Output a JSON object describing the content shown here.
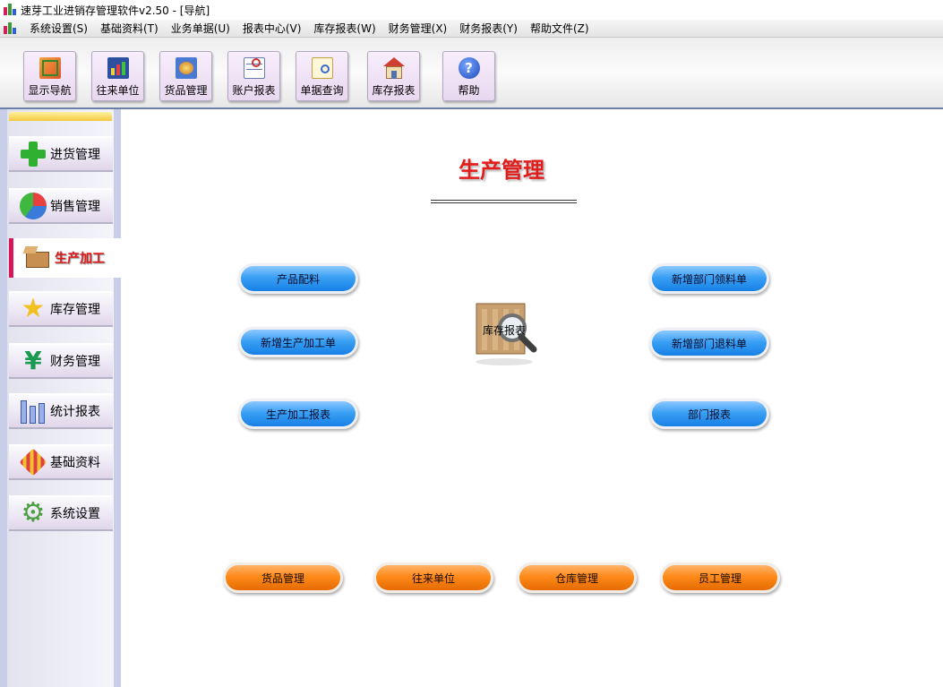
{
  "window": {
    "title": "速芽工业进销存管理软件v2.50 - [导航]"
  },
  "menu": [
    "系统设置(S)",
    "基础资料(T)",
    "业务单据(U)",
    "报表中心(V)",
    "库存报表(W)",
    "财务管理(X)",
    "财务报表(Y)",
    "帮助文件(Z)"
  ],
  "toolbar": [
    {
      "label": "显示导航",
      "icon": "navigation-icon"
    },
    {
      "label": "往来单位",
      "icon": "partners-chart-icon"
    },
    {
      "label": "货品管理",
      "icon": "goods-icon"
    },
    {
      "label": "账户报表",
      "icon": "account-report-icon"
    },
    {
      "label": "单据查询",
      "icon": "document-search-icon"
    },
    {
      "label": "库存报表",
      "icon": "warehouse-icon"
    },
    {
      "label": "帮助",
      "icon": "help-icon"
    }
  ],
  "sidebar": {
    "items": [
      {
        "label": "进货管理",
        "icon": "plus-icon"
      },
      {
        "label": "销售管理",
        "icon": "pie-chart-icon"
      },
      {
        "label": "生产加工",
        "icon": "box-icon",
        "active": true
      },
      {
        "label": "库存管理",
        "icon": "star-icon"
      },
      {
        "label": "财务管理",
        "icon": "yen-icon"
      },
      {
        "label": "统计报表",
        "icon": "bar-chart-icon"
      },
      {
        "label": "基础资料",
        "icon": "tools-icon"
      },
      {
        "label": "系统设置",
        "icon": "gear-icon"
      }
    ]
  },
  "main": {
    "heading": "生产管理",
    "left_buttons": [
      "产品配料",
      "新增生产加工单",
      "生产加工报表"
    ],
    "right_buttons": [
      "新增部门领料单",
      "新增部门退料单",
      "部门报表"
    ],
    "center": {
      "label": "库存报表",
      "icon": "inventory-magnifier-icon"
    },
    "bottom_buttons": [
      "货品管理",
      "往来单位",
      "仓库管理",
      "员工管理"
    ]
  },
  "colors": {
    "heading": "#e21b1b",
    "active_bar": "#d8175a",
    "blue_button": "#1680e6",
    "orange_button": "#ff8a1a"
  }
}
